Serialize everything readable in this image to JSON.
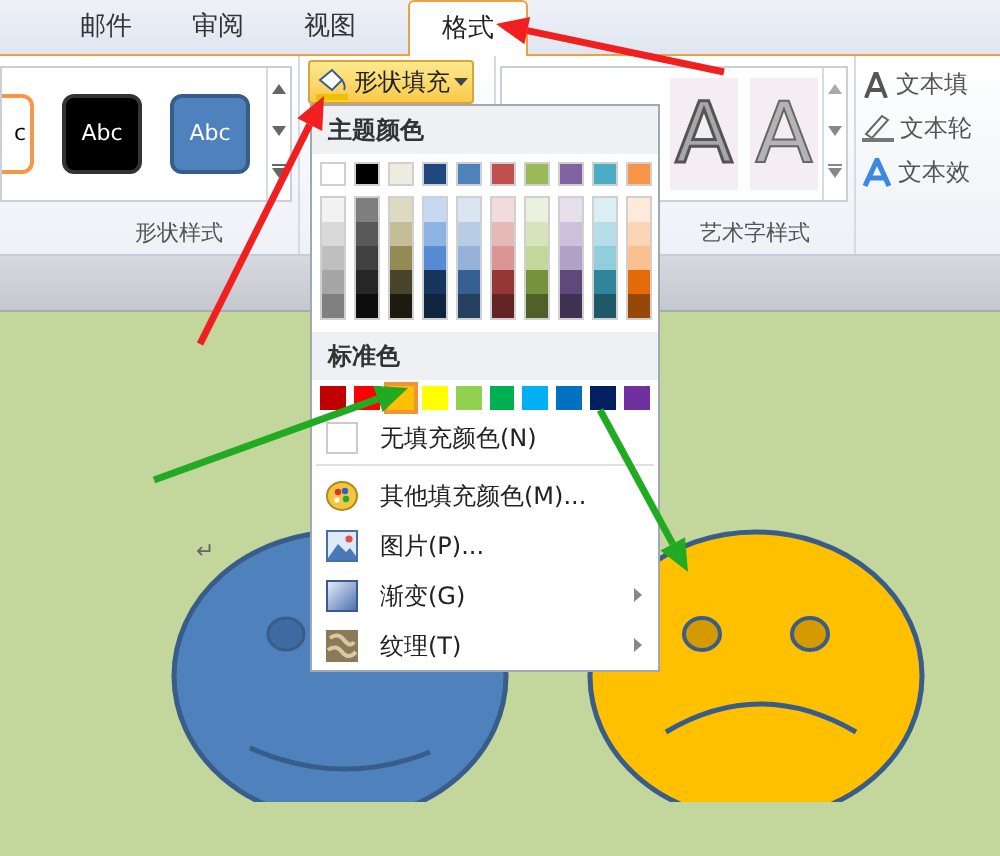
{
  "tabs": [
    {
      "label": "邮件",
      "selected": false
    },
    {
      "label": "审阅",
      "selected": false
    },
    {
      "label": "视图",
      "selected": false
    },
    {
      "label": "格式",
      "selected": true
    }
  ],
  "shape_styles": {
    "items": [
      {
        "label": "c",
        "kind": "outline"
      },
      {
        "label": "Abc",
        "kind": "dark"
      },
      {
        "label": "Abc",
        "kind": "blue"
      }
    ],
    "group_label": "形状样式"
  },
  "shape_fill_button": {
    "label": "形状填充"
  },
  "wordart_styles": {
    "items": [
      {
        "label": "A",
        "kind": "outlined"
      },
      {
        "label": "A",
        "kind": "faded"
      }
    ],
    "group_label": "艺术字样式"
  },
  "text_commands": [
    {
      "label": "文本填",
      "kind": "fill"
    },
    {
      "label": "文本轮",
      "kind": "outline"
    },
    {
      "label": "文本效",
      "kind": "effect"
    }
  ],
  "fill_menu": {
    "theme_title": "主题颜色",
    "theme_colors": [
      {
        "color": "#ffffff",
        "shades": [
          {
            "color": "#f2f2f2"
          },
          {
            "color": "#d9d9d9"
          },
          {
            "color": "#bfbfbf"
          },
          {
            "color": "#a6a6a6"
          },
          {
            "color": "#808080"
          }
        ]
      },
      {
        "color": "#000000",
        "shades": [
          {
            "color": "#7f7f7f"
          },
          {
            "color": "#595959"
          },
          {
            "color": "#404040"
          },
          {
            "color": "#262626"
          },
          {
            "color": "#0d0d0d"
          }
        ]
      },
      {
        "color": "#eeece1",
        "shades": [
          {
            "color": "#ddd9c3"
          },
          {
            "color": "#c4bd97"
          },
          {
            "color": "#948a54"
          },
          {
            "color": "#4a452a"
          },
          {
            "color": "#1d1b10"
          }
        ]
      },
      {
        "color": "#1f497d",
        "shades": [
          {
            "color": "#c6d9f0"
          },
          {
            "color": "#8db3e2"
          },
          {
            "color": "#548dd4"
          },
          {
            "color": "#17365d"
          },
          {
            "color": "#0f243e"
          }
        ]
      },
      {
        "color": "#4f81bd",
        "shades": [
          {
            "color": "#dbe5f1"
          },
          {
            "color": "#b8cce4"
          },
          {
            "color": "#95b3d7"
          },
          {
            "color": "#366092"
          },
          {
            "color": "#244061"
          }
        ]
      },
      {
        "color": "#c0504d",
        "shades": [
          {
            "color": "#f2dcdb"
          },
          {
            "color": "#e5b9b7"
          },
          {
            "color": "#d99694"
          },
          {
            "color": "#953734"
          },
          {
            "color": "#632423"
          }
        ]
      },
      {
        "color": "#9bbb59",
        "shades": [
          {
            "color": "#ebf1dd"
          },
          {
            "color": "#d7e3bc"
          },
          {
            "color": "#c3d69b"
          },
          {
            "color": "#76923c"
          },
          {
            "color": "#4f6128"
          }
        ]
      },
      {
        "color": "#8064a2",
        "shades": [
          {
            "color": "#e5e0ec"
          },
          {
            "color": "#ccc1d9"
          },
          {
            "color": "#b2a2c7"
          },
          {
            "color": "#5f497a"
          },
          {
            "color": "#3f3151"
          }
        ]
      },
      {
        "color": "#4bacc6",
        "shades": [
          {
            "color": "#dbeef3"
          },
          {
            "color": "#b7dde8"
          },
          {
            "color": "#92cddc"
          },
          {
            "color": "#31859b"
          },
          {
            "color": "#205867"
          }
        ]
      },
      {
        "color": "#f79646",
        "shades": [
          {
            "color": "#fdeada"
          },
          {
            "color": "#fbd5b5"
          },
          {
            "color": "#fac08f"
          },
          {
            "color": "#e36c09"
          },
          {
            "color": "#974806"
          }
        ]
      }
    ],
    "standard_title": "标准色",
    "standard_colors": [
      {
        "color": "#c00000",
        "selected": false
      },
      {
        "color": "#ff0000",
        "selected": false
      },
      {
        "color": "#ffc000",
        "selected": true
      },
      {
        "color": "#ffff00",
        "selected": false
      },
      {
        "color": "#92d050",
        "selected": false
      },
      {
        "color": "#00b050",
        "selected": false
      },
      {
        "color": "#00b0f0",
        "selected": false
      },
      {
        "color": "#0070c0",
        "selected": false
      },
      {
        "color": "#002060",
        "selected": false
      },
      {
        "color": "#7030a0",
        "selected": false
      }
    ],
    "no_fill": "无填充颜色(N)",
    "items": [
      {
        "label": "其他填充颜色(M)...",
        "kind": "palette",
        "has_submenu": false
      },
      {
        "label": "图片(P)...",
        "kind": "picture",
        "has_submenu": false
      },
      {
        "label": "渐变(G)",
        "kind": "gradient",
        "has_submenu": true
      },
      {
        "label": "纹理(T)",
        "kind": "texture",
        "has_submenu": true
      }
    ]
  },
  "document": {
    "paragraph_mark": "↵"
  }
}
